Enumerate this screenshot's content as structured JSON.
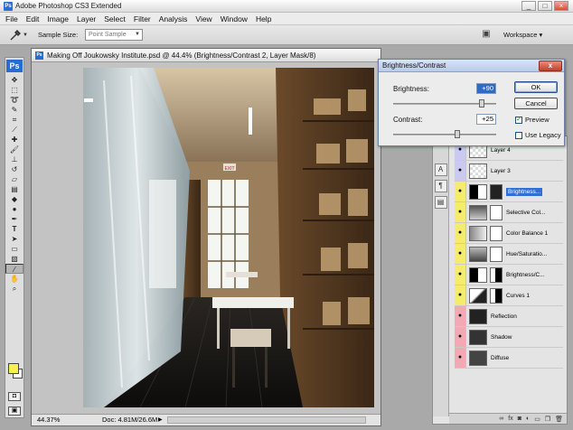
{
  "app": {
    "title": "Adobe Photoshop CS3 Extended",
    "icon": "ps-app-icon"
  },
  "window_controls": {
    "minimize": "_",
    "maximize": "□",
    "close": "×"
  },
  "menu": [
    "File",
    "Edit",
    "Image",
    "Layer",
    "Select",
    "Filter",
    "Analysis",
    "View",
    "Window",
    "Help"
  ],
  "options": {
    "tool_icon": "eyedropper-icon",
    "sample_size_label": "Sample Size:",
    "sample_size_value": "Point Sample",
    "workspace_label": "Workspace ▾"
  },
  "toolbox": {
    "logo": "Ps",
    "tools": [
      "move-icon",
      "marquee-icon",
      "lasso-icon",
      "quick-select-icon",
      "crop-icon",
      "slice-icon",
      "healing-icon",
      "brush-icon",
      "clone-stamp-icon",
      "history-brush-icon",
      "eraser-icon",
      "gradient-icon",
      "blur-icon",
      "dodge-icon",
      "pen-icon",
      "type-icon",
      "path-select-icon",
      "shape-icon",
      "notes-icon",
      "eyedropper-icon",
      "hand-icon",
      "zoom-icon"
    ],
    "fg_color": "#f6f050",
    "bg_color": "#ffffff"
  },
  "document": {
    "title": "Making Off Joukowsky Institute.psd @ 44.4% (Brightness/Contrast 2, Layer Mask/8)",
    "zoom": "44.37%",
    "doc_size": "Doc: 4.81M/26.6M",
    "exit_sign": "EXIT"
  },
  "dialog": {
    "title": "Brightness/Contrast",
    "brightness_label": "Brightness:",
    "brightness_value": "+90",
    "brightness_level": 0.86,
    "contrast_label": "Contrast:",
    "contrast_value": "+25",
    "contrast_level": 0.62,
    "ok": "OK",
    "cancel": "Cancel",
    "preview_label": "Preview",
    "preview_checked": true,
    "legacy_label": "Use Legacy",
    "legacy_checked": false,
    "close": "x"
  },
  "layers": [
    {
      "name": "Layer 4",
      "color": "#c9c9f2"
    },
    {
      "name": "Layer 3",
      "color": "#c9c9f2"
    },
    {
      "name": "Brightness...",
      "color": "#f4ec6a",
      "selected": true
    },
    {
      "name": "Selective Col...",
      "color": "#f4ec6a"
    },
    {
      "name": "Color Balance 1",
      "color": "#f4ec6a"
    },
    {
      "name": "Hue/Saturatio...",
      "color": "#f4ec6a"
    },
    {
      "name": "Brightness/C...",
      "color": "#f4ec6a"
    },
    {
      "name": "Curves 1",
      "color": "#f4ec6a"
    },
    {
      "name": "Reflection",
      "color": "#f2a9b3"
    },
    {
      "name": "Shadow",
      "color": "#f2a9b3"
    },
    {
      "name": "Diffuse",
      "color": "#f2a9b3"
    }
  ],
  "layer_footer": [
    "link-icon",
    "fx-icon",
    "mask-icon",
    "adjustment-icon",
    "group-icon",
    "new-layer-icon",
    "trash-icon"
  ]
}
